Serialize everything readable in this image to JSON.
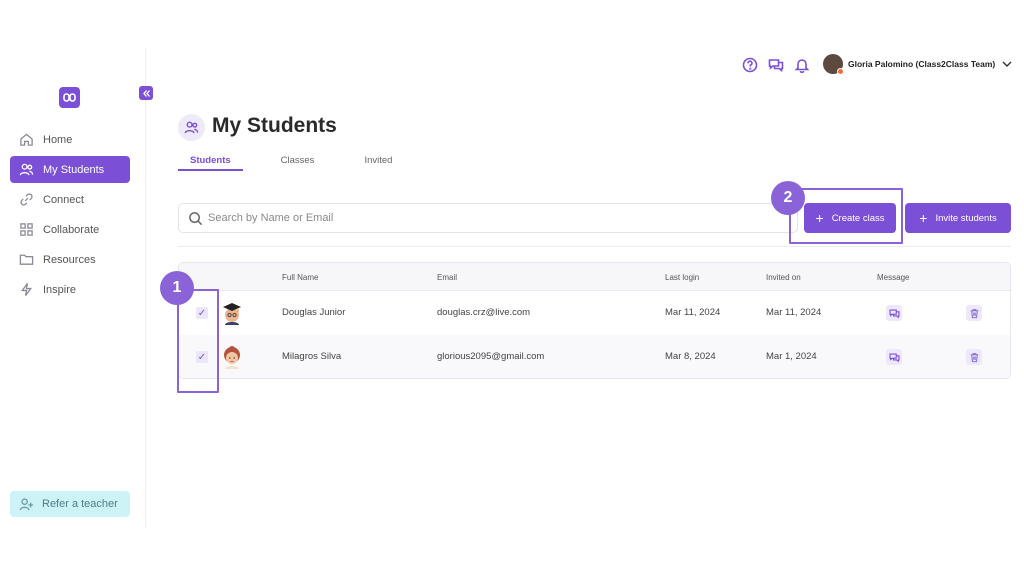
{
  "sidebar": {
    "items": [
      {
        "label": "Home",
        "icon": "home-icon"
      },
      {
        "label": "My Students",
        "icon": "users-icon",
        "active": true
      },
      {
        "label": "Connect",
        "icon": "link-icon"
      },
      {
        "label": "Collaborate",
        "icon": "grid-icon"
      },
      {
        "label": "Resources",
        "icon": "folder-icon"
      },
      {
        "label": "Inspire",
        "icon": "bolt-icon"
      }
    ],
    "refer_label": "Refer a teacher"
  },
  "header": {
    "user_name": "Gloria Palomino (Class2Class Team)"
  },
  "page": {
    "title": "My Students",
    "tabs": [
      {
        "label": "Students",
        "active": true
      },
      {
        "label": "Classes"
      },
      {
        "label": "Invited"
      }
    ]
  },
  "search": {
    "placeholder": "Search by Name or Email",
    "value": ""
  },
  "actions": {
    "create_class": "Create class",
    "invite_students": "Invite students",
    "plus": "+"
  },
  "table": {
    "headers": {
      "full_name": "Full Name",
      "email": "Email",
      "last_login": "Last login",
      "invited_on": "Invited on",
      "message": "Message"
    },
    "rows": [
      {
        "name": "Douglas Junior",
        "email": "douglas.crz@live.com",
        "last_login": "Mar 11, 2024",
        "invited_on": "Mar 11, 2024",
        "checked": "✓"
      },
      {
        "name": "Milagros Silva",
        "email": "glorious2095@gmail.com",
        "last_login": "Mar 8, 2024",
        "invited_on": "Mar 1, 2024",
        "checked": "✓"
      }
    ]
  },
  "annotations": {
    "marker_1": "1",
    "marker_2": "2"
  },
  "colors": {
    "accent": "#7b4fd6",
    "annotation": "#8a63d9",
    "refer_bg": "#cdf3f6"
  }
}
